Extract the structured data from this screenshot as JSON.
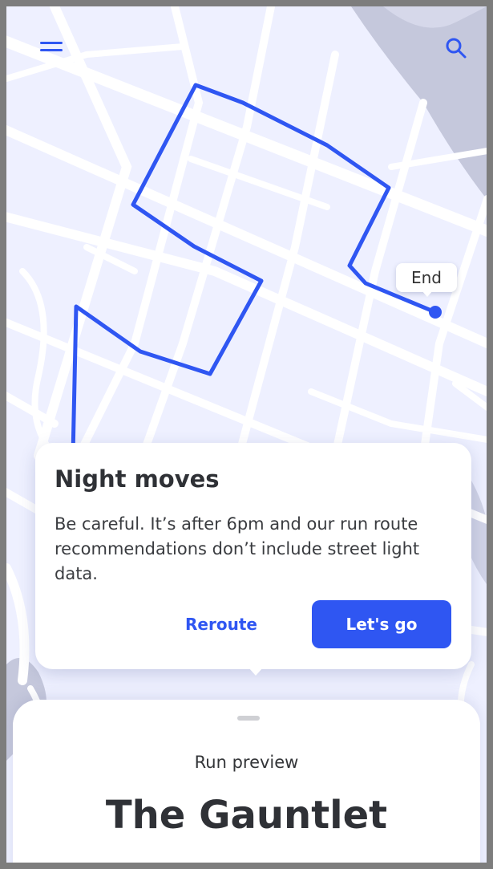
{
  "map": {
    "end_label": "End",
    "colors": {
      "background": "#eef0ff",
      "road": "#ffffff",
      "water": "#c5c8dc",
      "route": "#2f56f2"
    },
    "icons": {
      "menu": "menu-icon",
      "search": "search-icon",
      "end_marker": "end-point-marker"
    }
  },
  "alert": {
    "title": "Night moves",
    "body": "Be careful. It’s after 6pm and our run route recommendations don’t include street light data.",
    "reroute_label": "Reroute",
    "go_label": "Let's go"
  },
  "sheet": {
    "subtitle": "Run preview",
    "title": "The Gauntlet"
  },
  "colors": {
    "accent": "#2f56f2",
    "text_primary": "#2f3136",
    "card": "#ffffff"
  }
}
